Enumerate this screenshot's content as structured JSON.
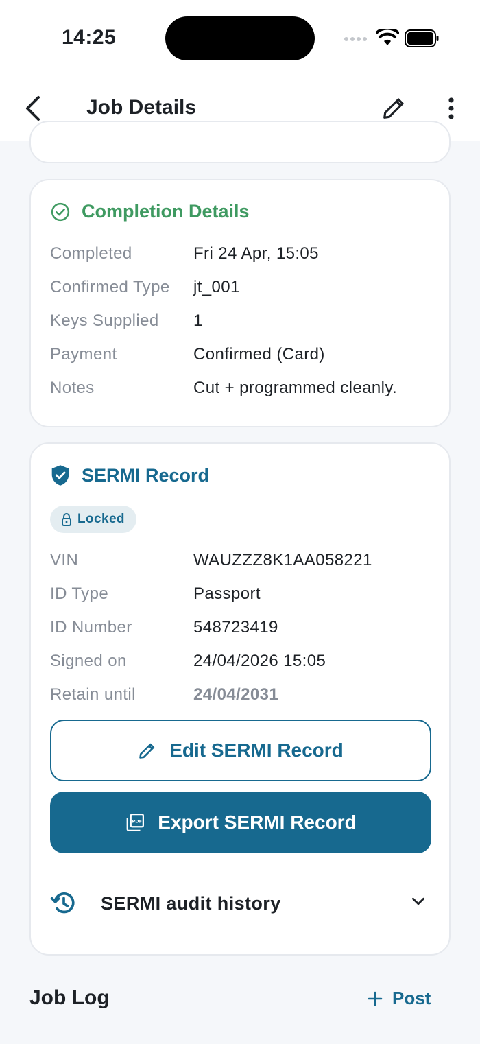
{
  "status_bar": {
    "time": "14:25"
  },
  "nav": {
    "title": "Job Details"
  },
  "completion": {
    "title": "Completion Details",
    "rows": [
      {
        "label": "Completed",
        "value": "Fri 24 Apr, 15:05"
      },
      {
        "label": "Confirmed Type",
        "value": "jt_001"
      },
      {
        "label": "Keys Supplied",
        "value": "1"
      },
      {
        "label": "Payment",
        "value": "Confirmed (Card)"
      },
      {
        "label": "Notes",
        "value": "Cut + programmed cleanly."
      }
    ]
  },
  "sermi": {
    "title": "SERMI Record",
    "status_chip": "Locked",
    "rows": [
      {
        "label": "VIN",
        "value": "WAUZZZ8K1AA058221"
      },
      {
        "label": "ID Type",
        "value": "Passport"
      },
      {
        "label": "ID Number",
        "value": "548723419"
      },
      {
        "label": "Signed on",
        "value": "24/04/2026 15:05"
      },
      {
        "label": "Retain until",
        "value": "24/04/2031"
      }
    ],
    "edit_button": "Edit SERMI Record",
    "export_button": "Export SERMI Record",
    "audit_history": "SERMI audit history"
  },
  "job_log": {
    "title": "Job Log",
    "post_button": "Post"
  },
  "colors": {
    "accent": "#17698f",
    "success": "#3f9a61",
    "muted": "#868c96"
  },
  "icons": [
    "back-icon",
    "pencil-icon",
    "more-icon",
    "check-circle-icon",
    "shield-check-icon",
    "lock-icon",
    "pdf-icon",
    "history-icon",
    "chevron-down-icon",
    "plus-icon"
  ]
}
